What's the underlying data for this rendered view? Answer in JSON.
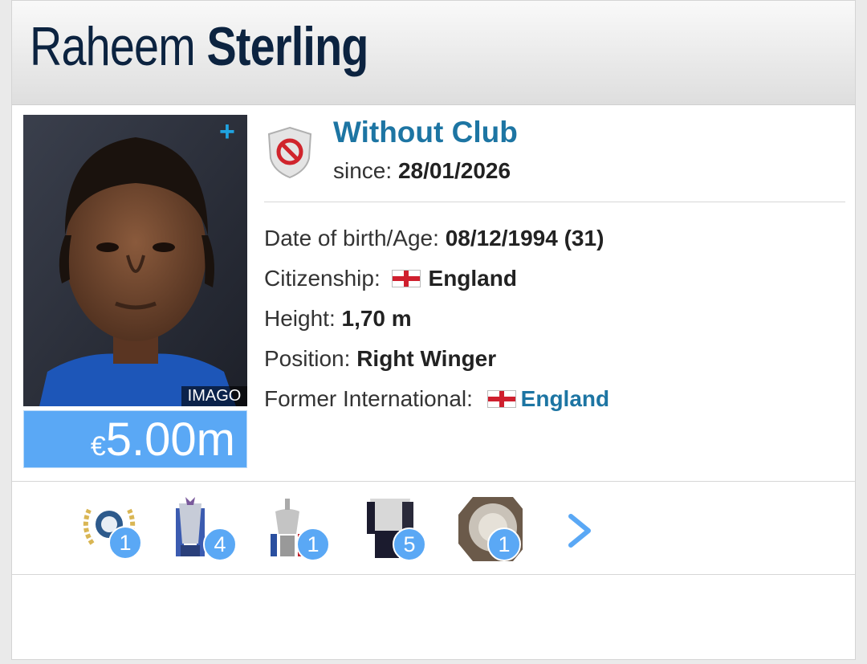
{
  "player": {
    "first_name": "Raheem",
    "last_name": "Sterling",
    "photo_credit": "IMAGO",
    "market_value_currency": "€",
    "market_value_amount": "5.00m"
  },
  "club": {
    "name": "Without Club",
    "since_label": "since:",
    "since_value": "28/01/2026",
    "icon": "no-club-shield-icon"
  },
  "details": [
    {
      "label": "Date of birth/Age:",
      "value": "08/12/1994 (31)"
    },
    {
      "label": "Citizenship:",
      "value": "England",
      "flag": "england-flag"
    },
    {
      "label": "Height:",
      "value": "1,70 m"
    },
    {
      "label": "Position:",
      "value": "Right Winger"
    },
    {
      "label": "Former International:",
      "value": "England",
      "flag": "england-flag",
      "link": true
    }
  ],
  "trophies": [
    {
      "icon": "award-wreath-icon",
      "count": "1"
    },
    {
      "icon": "premier-league-trophy-icon",
      "count": "4"
    },
    {
      "icon": "fa-cup-trophy-icon",
      "count": "1"
    },
    {
      "icon": "league-cup-trophy-icon",
      "count": "5"
    },
    {
      "icon": "community-shield-icon",
      "count": "1"
    }
  ],
  "colors": {
    "title": "#0c2340",
    "link": "#1d75a3",
    "value_bg": "#5aa8f5",
    "badge": "#5aa8f5"
  }
}
